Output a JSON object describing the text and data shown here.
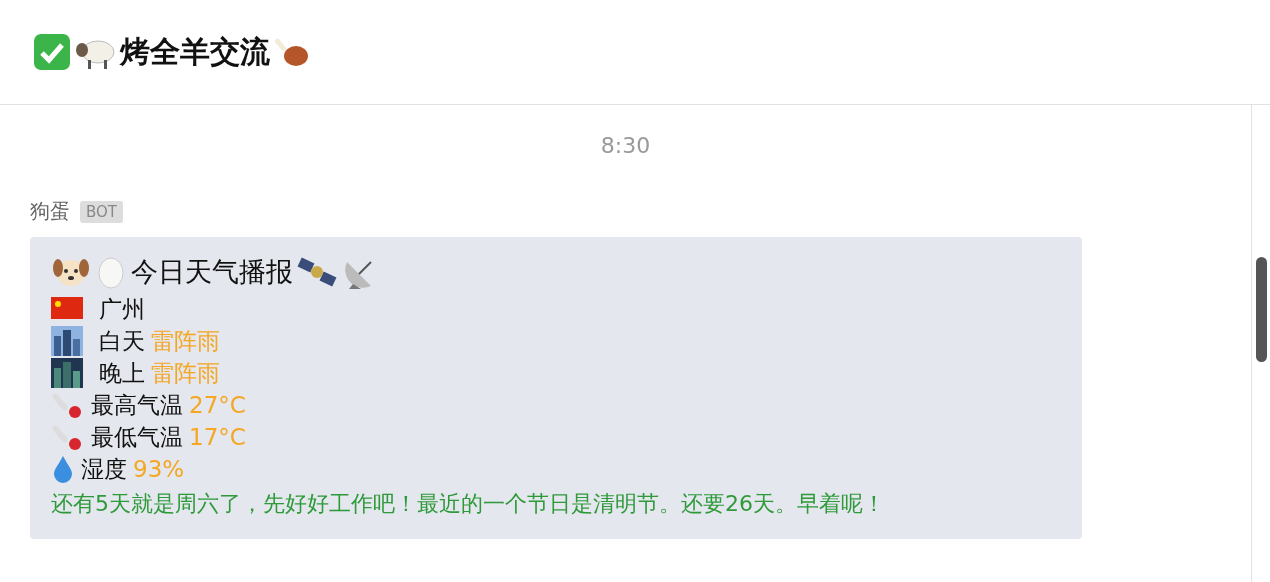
{
  "chat": {
    "title": "烤全羊交流"
  },
  "time": "8:30",
  "message": {
    "sender": "狗蛋",
    "badge": "BOT",
    "heading": "今日天气播报",
    "lines": [
      {
        "kind": "place",
        "label": "广州"
      },
      {
        "kind": "day",
        "label": "白天",
        "value": "雷阵雨"
      },
      {
        "kind": "night",
        "label": "晚上",
        "value": "雷阵雨"
      },
      {
        "kind": "temp",
        "label": "最高气温",
        "value": "27°C"
      },
      {
        "kind": "temp",
        "label": "最低气温",
        "value": "17°C"
      },
      {
        "kind": "humidity",
        "label": "湿度",
        "value": "93%"
      }
    ],
    "footer": "还有5天就是周六了，先好好工作吧！最近的一个节日是清明节。还要26天。早着呢！"
  }
}
